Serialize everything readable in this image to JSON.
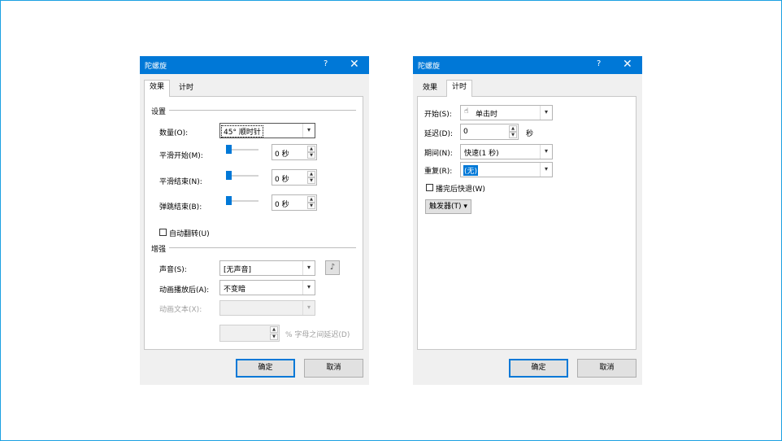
{
  "dialog1": {
    "title": "陀螺旋",
    "help": "?",
    "close": "✕",
    "tabs": [
      "效果",
      "计时"
    ],
    "settings": {
      "header": "设置",
      "amount_label": "数量(O):",
      "amount_value": "45° 顺时针",
      "smooth_start_label": "平滑开始(M):",
      "smooth_start_value": "0 秒",
      "smooth_end_label": "平滑结束(N):",
      "smooth_end_value": "0 秒",
      "bounce_end_label": "弹跳结束(B):",
      "bounce_end_value": "0 秒",
      "auto_reverse_label": "自动翻转(U)"
    },
    "enhancements": {
      "header": "增强",
      "sound_label": "声音(S):",
      "sound_value": "[无声音]",
      "after_anim_label": "动画播放后(A):",
      "after_anim_value": "不变暗",
      "anim_text_label": "动画文本(X):",
      "anim_text_value": "",
      "delay_suffix": "% 字母之间延迟(D)"
    },
    "ok": "确定",
    "cancel": "取消"
  },
  "dialog2": {
    "title": "陀螺旋",
    "help": "?",
    "close": "✕",
    "tabs": [
      "效果",
      "计时"
    ],
    "start_label": "开始(S):",
    "start_value": "单击时",
    "delay_label": "延迟(D):",
    "delay_value": "0",
    "delay_unit": "秒",
    "duration_label": "期间(N):",
    "duration_value": "快速(1 秒)",
    "repeat_label": "重复(R):",
    "repeat_value": "(无)",
    "rewind_label": "播完后快退(W)",
    "triggers_label": "触发器(T)",
    "ok": "确定",
    "cancel": "取消"
  }
}
